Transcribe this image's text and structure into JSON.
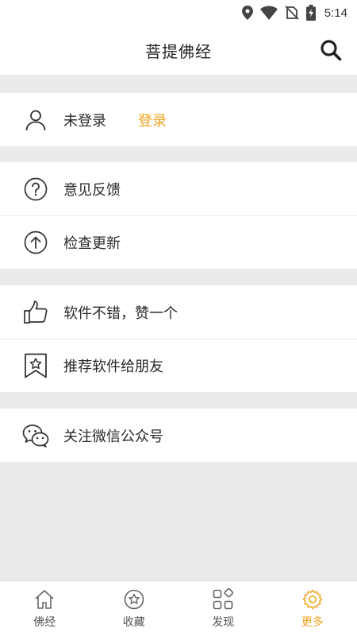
{
  "status_bar": {
    "time": "5:14"
  },
  "header": {
    "title": "菩提佛经"
  },
  "account": {
    "status": "未登录",
    "login_label": "登录"
  },
  "menu": {
    "feedback": "意见反馈",
    "check_update": "检查更新",
    "rate_app": "软件不错，赞一个",
    "recommend": "推荐软件给朋友",
    "wechat": "关注微信公众号"
  },
  "tabs": [
    {
      "label": "佛经",
      "icon": "home-icon"
    },
    {
      "label": "收藏",
      "icon": "star-icon"
    },
    {
      "label": "发现",
      "icon": "grid-icon"
    },
    {
      "label": "更多",
      "icon": "gear-icon"
    }
  ],
  "colors": {
    "accent": "#f0a422",
    "background": "#ebebeb"
  }
}
